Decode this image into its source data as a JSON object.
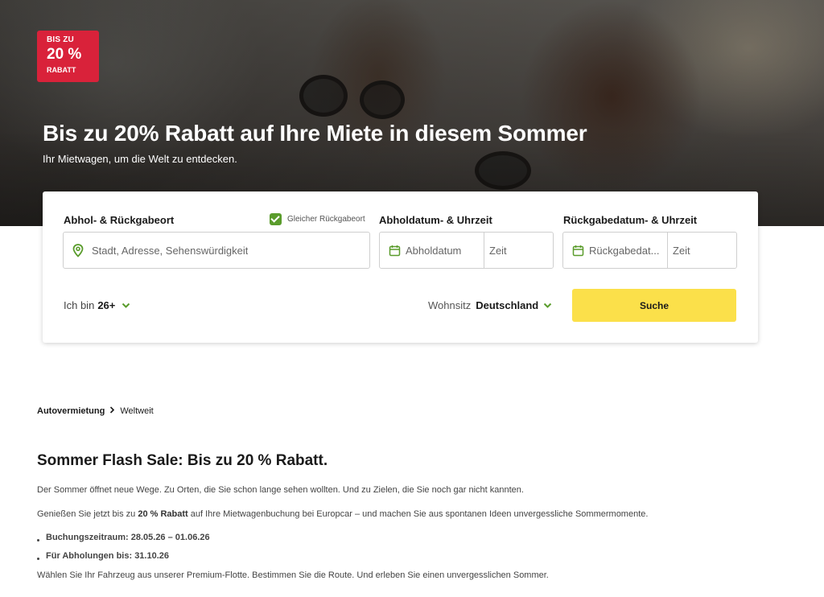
{
  "hero": {
    "badge": {
      "line1": "BIS ZU",
      "line2": "20 %",
      "line3": "RABATT"
    },
    "title": "Bis zu 20% Rabatt auf Ihre Miete in diesem Sommer",
    "subtitle": "Ihr Mietwagen, um die Welt zu entdecken."
  },
  "search": {
    "location_label": "Abhol- & Rückgabeort",
    "same_return_label": "Gleicher Rückgabeort",
    "same_return_checked": true,
    "location_placeholder": "Stadt, Adresse, Sehenswürdigkeit",
    "pickup_label": "Abholdatum- & Uhrzeit",
    "pickup_date_placeholder": "Abholdatum",
    "pickup_time_placeholder": "Zeit",
    "return_label": "Rückgabedatum- & Uhrzeit",
    "return_date_placeholder": "Rückgabedat...",
    "return_time_placeholder": "Zeit",
    "age_prefix": "Ich bin",
    "age_value": "26+",
    "residence_prefix": "Wohnsitz",
    "residence_value": "Deutschland",
    "search_button": "Suche",
    "accent_color": "#5a9c2c",
    "button_color": "#fbe04a"
  },
  "breadcrumb": {
    "item1": "Autovermietung",
    "item2": "Weltweit"
  },
  "content": {
    "title": "Sommer Flash Sale: Bis zu 20 % Rabatt.",
    "para1": "Der Sommer öffnet neue Wege. Zu Orten, die Sie schon lange sehen wollten. Und zu Zielen, die Sie noch gar nicht kannten.",
    "para2_before": "Genießen Sie jetzt bis zu ",
    "para2_bold": "20 % Rabatt",
    "para2_after": " auf Ihre Mietwagenbuchung bei Europcar – und machen Sie aus spontanen Ideen unvergessliche Sommermomente.",
    "bullets": [
      "Buchungszeitraum: 28.05.26 – 01.06.26",
      "Für Abholungen bis: 31.10.26"
    ],
    "para3": "Wählen Sie Ihr Fahrzeug aus unserer Premium-Flotte. Bestimmen Sie die Route. Und erleben Sie einen unvergesslichen Sommer."
  },
  "icons": {
    "location": "map-pin-icon",
    "calendar": "calendar-icon",
    "chevron": "chevron-down-icon",
    "breadcrumb_separator": "chevron-right-icon"
  },
  "colors": {
    "badge": "#d9223a"
  }
}
